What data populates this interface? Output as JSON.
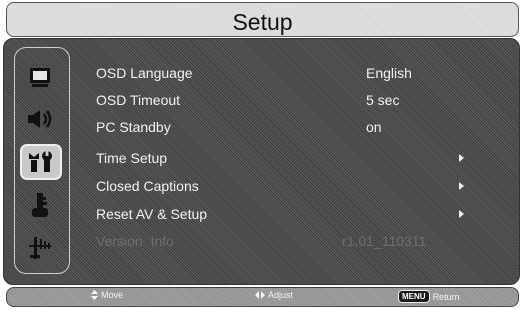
{
  "header": {
    "title": "Setup"
  },
  "sidebar": {
    "icons": [
      {
        "name": "picture-icon",
        "selected": false
      },
      {
        "name": "sound-icon",
        "selected": false
      },
      {
        "name": "setup-tools-icon",
        "selected": true
      },
      {
        "name": "lock-key-icon",
        "selected": false
      },
      {
        "name": "antenna-channel-icon",
        "selected": false
      }
    ]
  },
  "menu": {
    "items": [
      {
        "label": "OSD Language",
        "value": "English",
        "submenu": false,
        "enabled": true
      },
      {
        "label": "OSD Timeout",
        "value": "5 sec",
        "submenu": false,
        "enabled": true
      },
      {
        "label": "PC Standby",
        "value": "on",
        "submenu": false,
        "enabled": true
      },
      {
        "label": "Time Setup",
        "value": "",
        "submenu": true,
        "enabled": true
      },
      {
        "label": "Closed Captions",
        "value": "",
        "submenu": true,
        "enabled": true
      },
      {
        "label": "Reset AV & Setup",
        "value": "",
        "submenu": true,
        "enabled": true
      },
      {
        "label": "Version  Info",
        "value": "r1.01_110311",
        "submenu": false,
        "enabled": false
      }
    ]
  },
  "footer": {
    "move_label": "Move",
    "adjust_label": "Adjust",
    "menu_key": "MENU",
    "return_label": "Return"
  }
}
